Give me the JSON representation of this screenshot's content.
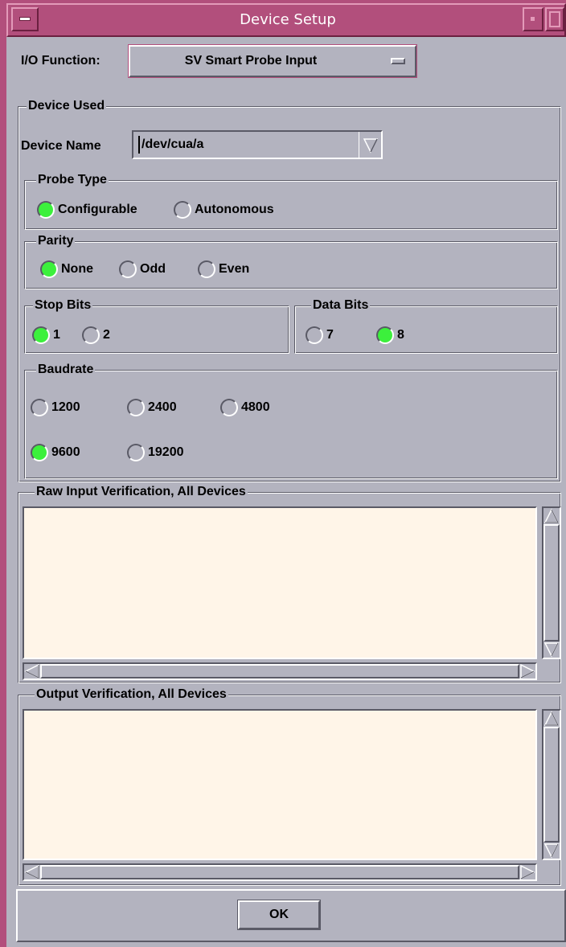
{
  "window": {
    "title": "Device Setup"
  },
  "io_function": {
    "label": "I/O Function:",
    "value": "SV Smart Probe Input"
  },
  "device_used": {
    "title": "Device Used",
    "device_name_label": "Device Name",
    "device_name_value": "/dev/cua/a"
  },
  "probe_type": {
    "title": "Probe Type",
    "options": [
      "Configurable",
      "Autonomous"
    ],
    "selected": "Configurable"
  },
  "parity": {
    "title": "Parity",
    "options": [
      "None",
      "Odd",
      "Even"
    ],
    "selected": "None"
  },
  "stop_bits": {
    "title": "Stop Bits",
    "options": [
      "1",
      "2"
    ],
    "selected": "1"
  },
  "data_bits": {
    "title": "Data Bits",
    "options": [
      "7",
      "8"
    ],
    "selected": "8"
  },
  "baudrate": {
    "title": "Baudrate",
    "options": [
      "1200",
      "2400",
      "4800",
      "9600",
      "19200"
    ],
    "selected": "9600"
  },
  "raw_input": {
    "title": "Raw Input Verification, All Devices",
    "text": ""
  },
  "output_verification": {
    "title": "Output Verification, All Devices",
    "text": ""
  },
  "ok_button": {
    "label": "OK"
  },
  "colors": {
    "titlebar": "#b24f7c",
    "window_bg": "#b3b3bf",
    "radio_selected": "#3cf03c",
    "text_area_bg": "#fff5e8"
  }
}
